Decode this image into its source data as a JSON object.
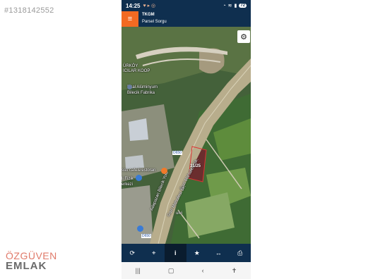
{
  "listing": {
    "id": "#1318142552"
  },
  "watermark": {
    "line1": "ÖZGÜVEN",
    "line2": "EMLAK"
  },
  "status_bar": {
    "time": "14:25",
    "battery": "72",
    "notification_icons": [
      "heart-icon",
      "location-icon",
      "instagram-icon"
    ],
    "system_icons": [
      "alarm-icon",
      "wifi-icon",
      "signal-icon"
    ]
  },
  "app_bar": {
    "menu_icon": "hamburger-icon",
    "menu_color": "#f26a22",
    "title": "TKGM",
    "subtitle": "Parsel Sorgu",
    "bar_color": "#0f2f4f"
  },
  "map": {
    "labels": {
      "koop_line1": "ÜRKÖY",
      "koop_line2": "ICILAR KOOP",
      "factory_line1": "Dzal Alüminyum",
      "factory_line2": "Bilecik Fabrika",
      "cafe": "ssu cafe&restoran",
      "fizik_line1": "li Fizik",
      "fizik_line2": "erkezi",
      "road_shield_1": "D650",
      "road_shield_2": "D650",
      "ulvi": "ulvi",
      "street_1": "Adapazarı Bilecik Yolu",
      "street_2": "Gazi Mahallesi Sk.",
      "street_3": "Gazi Mahallesi Sk.",
      "parcel_number": "31/25"
    },
    "settings_icon": "gear-icon"
  },
  "toolbar": {
    "buttons": [
      {
        "icon": "refresh-icon",
        "glyph": "⟳",
        "active": false
      },
      {
        "icon": "locate-icon",
        "glyph": "⌖",
        "active": false
      },
      {
        "icon": "info-icon",
        "glyph": "i",
        "active": true
      },
      {
        "icon": "star-icon",
        "glyph": "★",
        "active": false
      },
      {
        "icon": "measure-icon",
        "glyph": "↔",
        "active": false
      },
      {
        "icon": "print-icon",
        "glyph": "⎙",
        "active": false
      }
    ]
  },
  "nav_bar": {
    "buttons": [
      "recent-apps-icon",
      "home-icon",
      "back-icon",
      "accessibility-icon"
    ]
  }
}
